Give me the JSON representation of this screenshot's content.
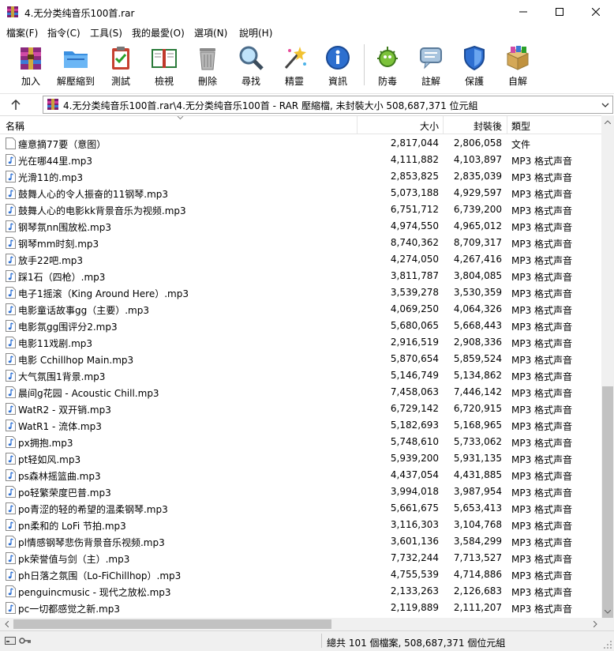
{
  "window": {
    "title": "4.无分类纯音乐100首.rar"
  },
  "menu": [
    {
      "label": "檔案(F)"
    },
    {
      "label": "指令(C)"
    },
    {
      "label": "工具(S)"
    },
    {
      "label": "我的最愛(O)"
    },
    {
      "label": "選項(N)"
    },
    {
      "label": "說明(H)"
    }
  ],
  "toolbar": [
    {
      "label": "加入",
      "icon": "add-archive-icon"
    },
    {
      "label": "解壓縮到",
      "icon": "extract-folder-icon"
    },
    {
      "label": "測試",
      "icon": "test-clipboard-icon"
    },
    {
      "label": "檢視",
      "icon": "view-book-icon"
    },
    {
      "label": "刪除",
      "icon": "trash-icon"
    },
    {
      "label": "尋找",
      "icon": "magnifier-icon"
    },
    {
      "label": "精靈",
      "icon": "wizard-wand-icon"
    },
    {
      "label": "資訊",
      "icon": "info-icon"
    },
    {
      "label": "防毒",
      "icon": "virus-scan-icon"
    },
    {
      "label": "註解",
      "icon": "comment-icon"
    },
    {
      "label": "保護",
      "icon": "shield-icon"
    },
    {
      "label": "自解",
      "icon": "sfx-box-icon"
    }
  ],
  "address": {
    "path": "4.无分类纯音乐100首.rar\\4.无分类纯音乐100首 - RAR 壓縮檔, 未封裝大小 508,687,371 位元組"
  },
  "columns": {
    "name": "名稱",
    "size": "大小",
    "packed": "封裝後",
    "type": "類型"
  },
  "files": [
    {
      "name": "瘗意摘77要（意图）",
      "size": "2,817,044",
      "packed": "2,806,058",
      "type": "文件",
      "icon": "file-icon"
    },
    {
      "name": "光在哪44里.mp3",
      "size": "4,111,882",
      "packed": "4,103,897",
      "type": "MP3 格式声音",
      "icon": "music-file-icon"
    },
    {
      "name": "光滑11的.mp3",
      "size": "2,853,825",
      "packed": "2,835,039",
      "type": "MP3 格式声音",
      "icon": "music-file-icon"
    },
    {
      "name": "鼓舞人心的令人振奋的11钢琴.mp3",
      "size": "5,073,188",
      "packed": "4,929,597",
      "type": "MP3 格式声音",
      "icon": "music-file-icon"
    },
    {
      "name": "鼓舞人心的电影kk背景音乐为视频.mp3",
      "size": "6,751,712",
      "packed": "6,739,200",
      "type": "MP3 格式声音",
      "icon": "music-file-icon"
    },
    {
      "name": "钢琴氛nn围放松.mp3",
      "size": "4,974,550",
      "packed": "4,965,012",
      "type": "MP3 格式声音",
      "icon": "music-file-icon"
    },
    {
      "name": "钢琴mm时刻.mp3",
      "size": "8,740,362",
      "packed": "8,709,317",
      "type": "MP3 格式声音",
      "icon": "music-file-icon"
    },
    {
      "name": "放手22吧.mp3",
      "size": "4,274,050",
      "packed": "4,267,416",
      "type": "MP3 格式声音",
      "icon": "music-file-icon"
    },
    {
      "name": "踩1石（四枪）.mp3",
      "size": "3,811,787",
      "packed": "3,804,085",
      "type": "MP3 格式声音",
      "icon": "music-file-icon"
    },
    {
      "name": "电子1摇滚（King Around Here）.mp3",
      "size": "3,539,278",
      "packed": "3,530,359",
      "type": "MP3 格式声音",
      "icon": "music-file-icon"
    },
    {
      "name": "电影童话故事gg（主要）.mp3",
      "size": "4,069,250",
      "packed": "4,064,326",
      "type": "MP3 格式声音",
      "icon": "music-file-icon"
    },
    {
      "name": "电影氛gg围评分2.mp3",
      "size": "5,680,065",
      "packed": "5,668,443",
      "type": "MP3 格式声音",
      "icon": "music-file-icon"
    },
    {
      "name": "电影11戏剧.mp3",
      "size": "2,916,519",
      "packed": "2,908,336",
      "type": "MP3 格式声音",
      "icon": "music-file-icon"
    },
    {
      "name": "电影 Cchillhop Main.mp3",
      "size": "5,870,654",
      "packed": "5,859,524",
      "type": "MP3 格式声音",
      "icon": "music-file-icon"
    },
    {
      "name": "大气氛围1背景.mp3",
      "size": "5,146,749",
      "packed": "5,134,862",
      "type": "MP3 格式声音",
      "icon": "music-file-icon"
    },
    {
      "name": "晨间g花园 - Acoustic Chill.mp3",
      "size": "7,458,063",
      "packed": "7,446,142",
      "type": "MP3 格式声音",
      "icon": "music-file-icon"
    },
    {
      "name": "WatR2 - 双开销.mp3",
      "size": "6,729,142",
      "packed": "6,720,915",
      "type": "MP3 格式声音",
      "icon": "music-file-icon"
    },
    {
      "name": "WatR1 - 流体.mp3",
      "size": "5,182,693",
      "packed": "5,168,965",
      "type": "MP3 格式声音",
      "icon": "music-file-icon"
    },
    {
      "name": "px拥抱.mp3",
      "size": "5,748,610",
      "packed": "5,733,062",
      "type": "MP3 格式声音",
      "icon": "music-file-icon"
    },
    {
      "name": "pt轻如风.mp3",
      "size": "5,939,200",
      "packed": "5,931,135",
      "type": "MP3 格式声音",
      "icon": "music-file-icon"
    },
    {
      "name": "ps森林摇篮曲.mp3",
      "size": "4,437,054",
      "packed": "4,431,885",
      "type": "MP3 格式声音",
      "icon": "music-file-icon"
    },
    {
      "name": "po轻繁荣度巴普.mp3",
      "size": "3,994,018",
      "packed": "3,987,954",
      "type": "MP3 格式声音",
      "icon": "music-file-icon"
    },
    {
      "name": "po青涩的轻的希望的温柔钢琴.mp3",
      "size": "5,661,675",
      "packed": "5,653,413",
      "type": "MP3 格式声音",
      "icon": "music-file-icon"
    },
    {
      "name": "pn柔和的 LoFi 节拍.mp3",
      "size": "3,116,303",
      "packed": "3,104,768",
      "type": "MP3 格式声音",
      "icon": "music-file-icon"
    },
    {
      "name": "pl情感钢琴悲伤背景音乐视频.mp3",
      "size": "3,601,136",
      "packed": "3,584,299",
      "type": "MP3 格式声音",
      "icon": "music-file-icon"
    },
    {
      "name": "pk荣誉值与剑（主）.mp3",
      "size": "7,732,244",
      "packed": "7,713,527",
      "type": "MP3 格式声音",
      "icon": "music-file-icon"
    },
    {
      "name": "ph日落之氛围（Lo-FiChillhop）.mp3",
      "size": "4,755,539",
      "packed": "4,714,886",
      "type": "MP3 格式声音",
      "icon": "music-file-icon"
    },
    {
      "name": "penguincmusic - 现代之放松.mp3",
      "size": "2,133,263",
      "packed": "2,126,683",
      "type": "MP3 格式声音",
      "icon": "music-file-icon"
    },
    {
      "name": "pc一切都感觉之新.mp3",
      "size": "2,119,889",
      "packed": "2,111,207",
      "type": "MP3 格式声音",
      "icon": "music-file-icon"
    }
  ],
  "status": {
    "text": "總共 101 個檔案, 508,687,371 個位元組"
  },
  "colors": {
    "border": "#dcdcdc",
    "scroll_thumb": "#c2c2c2",
    "status_bg": "#f0f0f0",
    "mp3_icon": "#2a6fd6"
  }
}
